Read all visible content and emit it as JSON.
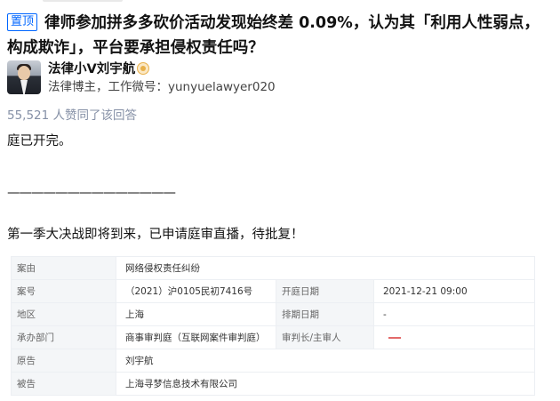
{
  "question": {
    "tag": "置顶",
    "title": "律师参加拼多多砍价活动发现始终差 0.09%，认为其「利用人性弱点，构成欺诈」，平台要承担侵权责任吗？"
  },
  "author": {
    "name": "法律小V刘宇航",
    "bio": "法律博主，工作微号：yunyuelawyer020",
    "badge": "badge-icon"
  },
  "votes_text": "55,521 人赞同了该回答",
  "body": {
    "p1": "庭已开完。",
    "divider": "——————————————",
    "p3": "第一季大决战即将到来，已申请庭审直播，待批复！"
  },
  "case_table": {
    "cause_label": "案由",
    "cause_value": "网络侵权责任纠纷",
    "case_no_label": "案号",
    "case_no_value": "（2021）沪0105民初7416号",
    "open_date_label": "开庭日期",
    "open_date_value": "2021-12-21 09:00",
    "region_label": "地区",
    "region_value": "上海",
    "schedule_label": "排期日期",
    "schedule_value": "-",
    "dept_label": "承办部门",
    "dept_value": "商事审判庭（互联网案件审判庭）",
    "judge_label": "审判长/主审人",
    "plaintiff_label": "原告",
    "plaintiff_value": "刘宇航",
    "defendant_label": "被告",
    "defendant_value": "上海寻梦信息技术有限公司"
  }
}
